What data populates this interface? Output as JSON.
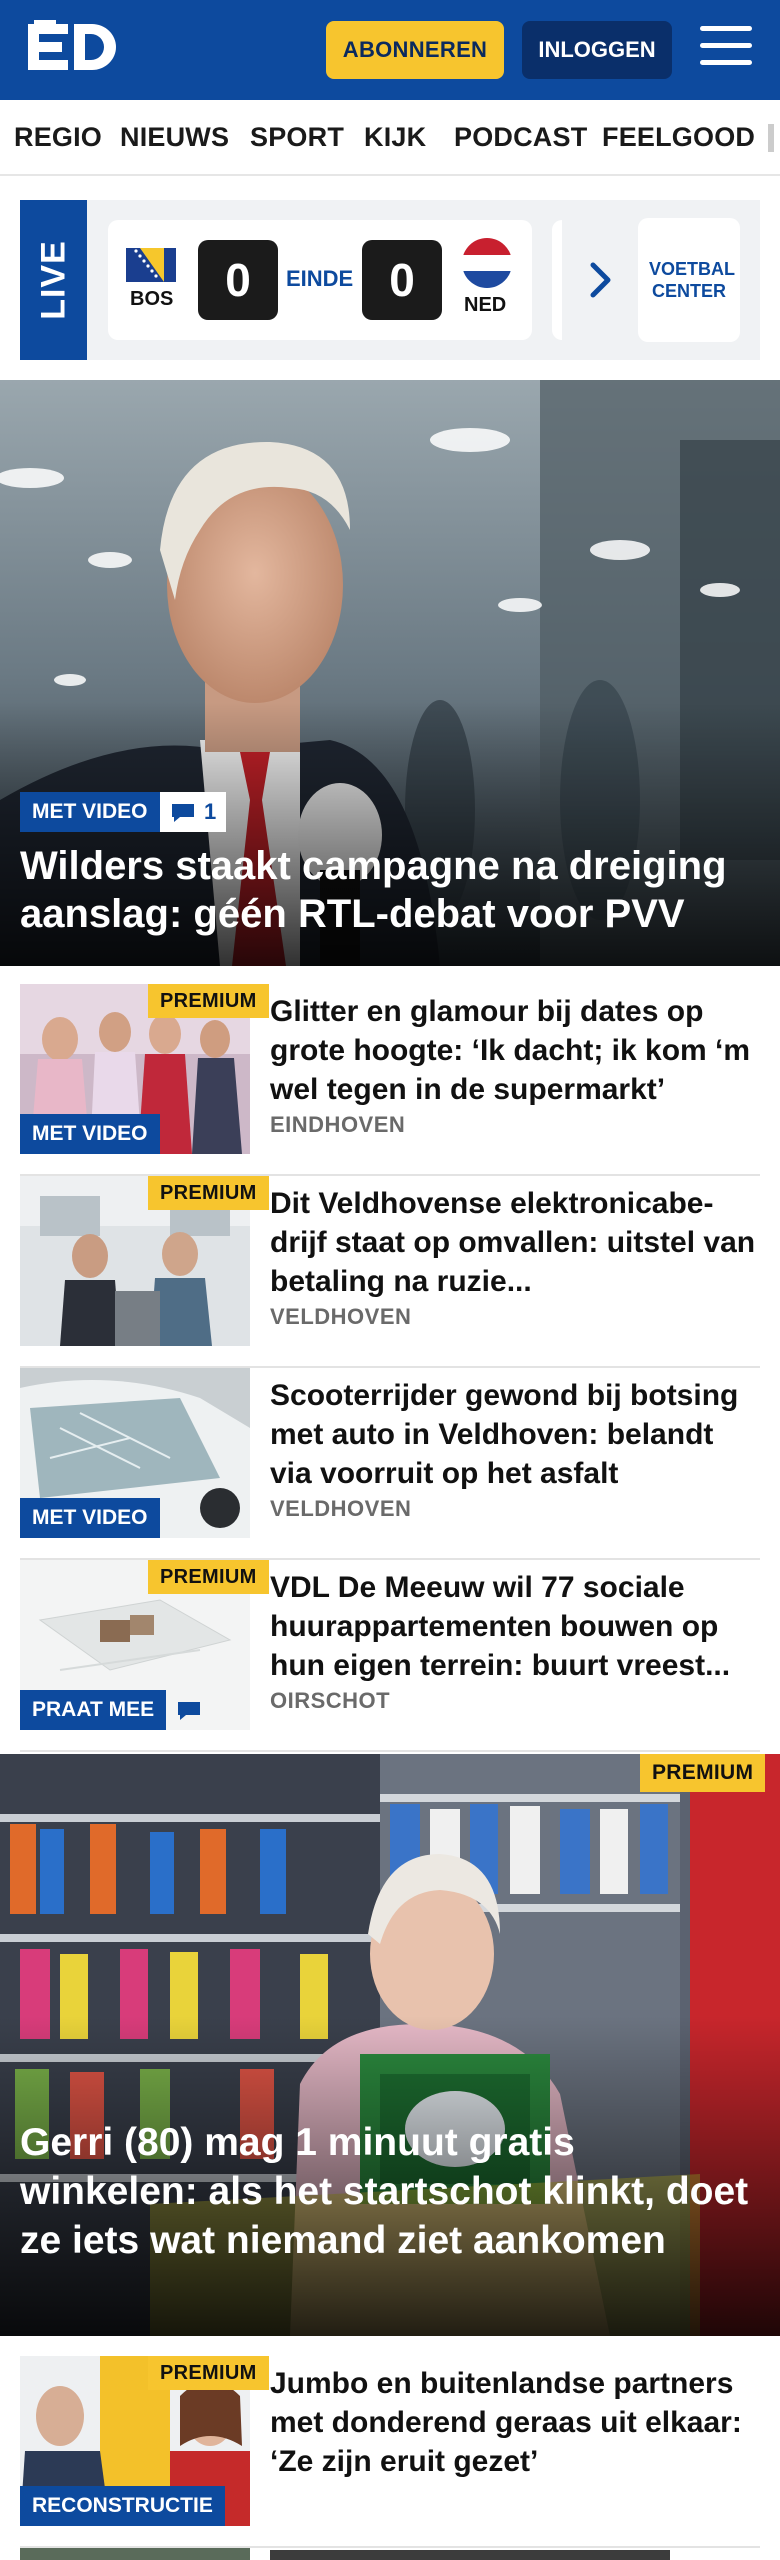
{
  "header": {
    "logo_text": "ED",
    "subscribe_label": "ABONNEREN",
    "login_label": "INLOGGEN",
    "colors": {
      "brand": "#0d4a9e",
      "accent": "#f7c52e"
    }
  },
  "nav": {
    "items": [
      "REGIO",
      "NIEUWS",
      "SPORT",
      "KIJK",
      "PODCAST",
      "FEELGOOD"
    ]
  },
  "live": {
    "label": "LIVE",
    "match": {
      "home_code": "BOS",
      "home_score": "0",
      "status": "EINDE",
      "away_score": "0",
      "away_code": "NED"
    },
    "voetbal_center_label": "VOETBAL CENTER"
  },
  "hero": {
    "video_tag": "MET VIDEO",
    "comment_count": "1",
    "title": "Wilders staakt campagne na dreiging aanslag: géén RTL-debat voor PVV"
  },
  "articles": [
    {
      "premium": "PREMIUM",
      "tag": "MET VIDEO",
      "title": "Glitter en glamour bij dates op grote hoogte: ‘Ik dacht; ik kom ‘m wel tegen in de supermarkt’",
      "location": "EINDHOVEN"
    },
    {
      "premium": "PREMIUM",
      "title": "Dit Veldhovense elektronicabe­drijf staat op omvallen: uitstel van betaling na ruzie...",
      "location": "VELDHOVEN"
    },
    {
      "tag": "MET VIDEO",
      "title": "Scooterrijder gewond bij botsing met auto in Veldhoven: belandt via voorruit op het asfalt",
      "location": "VELDHOVEN"
    },
    {
      "premium": "PREMIUM",
      "tag": "PRAAT MEE",
      "title": "VDL De Meeuw wil 77 sociale huurappartementen bouwen op hun eigen terrein: buurt vreest...",
      "location": "OIRSCHOT"
    }
  ],
  "big_article": {
    "premium": "PREMIUM",
    "title": "Gerri (80) mag 1 minuut gratis winkelen: als het startschot klinkt, doet ze iets wat niemand ziet aankomen"
  },
  "article_after": {
    "premium": "PREMIUM",
    "tag": "RECONSTRUCTIE",
    "title": "Jumbo en buitenlandse partners met donderend geraas uit elkaar: ‘Ze zijn eruit gezet’"
  }
}
